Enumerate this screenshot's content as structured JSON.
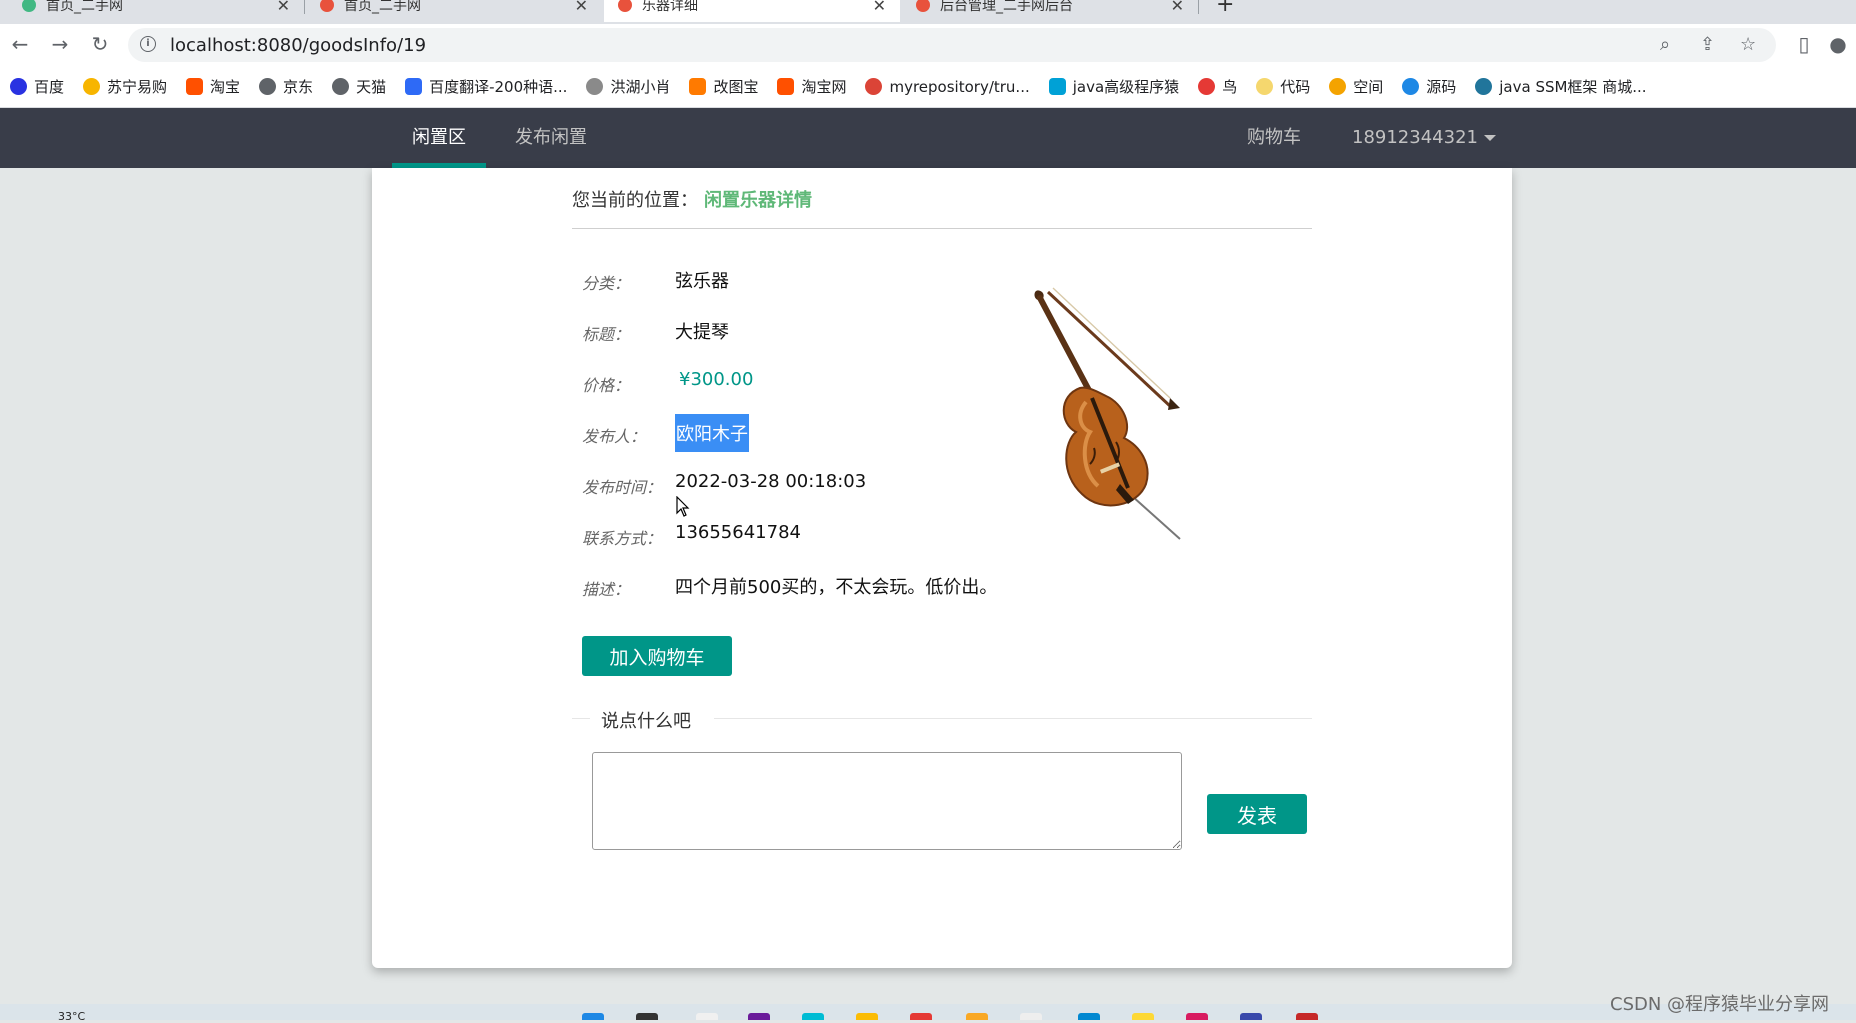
{
  "browser": {
    "tabs": [
      {
        "title": "首页_二手网",
        "favicon_color": "#41b883",
        "active": false
      },
      {
        "title": "首页_二手网",
        "favicon_color": "#e8523c",
        "active": false
      },
      {
        "title": "乐器详细",
        "favicon_color": "#e8523c",
        "active": true
      },
      {
        "title": "后台管理_二手网后台",
        "favicon_color": "#e8523c",
        "active": false
      }
    ],
    "url": "localhost:8080/goodsInfo/19",
    "bookmarks": [
      {
        "label": "百度",
        "color": "#2932e1"
      },
      {
        "label": "苏宁易购",
        "color": "#f7b500"
      },
      {
        "label": "淘宝",
        "color": "#ff5000"
      },
      {
        "label": "京东",
        "color": "#5f6368"
      },
      {
        "label": "天猫",
        "color": "#5f6368"
      },
      {
        "label": "百度翻译-200种语...",
        "color": "#2e6af6"
      },
      {
        "label": "洪湖小肖",
        "color": "#8a8a8a"
      },
      {
        "label": "改图宝",
        "color": "#ff7a00"
      },
      {
        "label": "淘宝网",
        "color": "#ff5000"
      },
      {
        "label": "myrepository/tru...",
        "color": "#db4437"
      },
      {
        "label": "java高级程序猿",
        "color": "#00a1d6"
      },
      {
        "label": "鸟",
        "color": "#e53935"
      },
      {
        "label": "代码",
        "color": "#f5d76e"
      },
      {
        "label": "空间",
        "color": "#f4a300"
      },
      {
        "label": "源码",
        "color": "#1e88e5"
      },
      {
        "label": "java SSM框架 商城...",
        "color": "#21759b"
      }
    ]
  },
  "navbar": {
    "left_items": [
      "闲置区",
      "发布闲置"
    ],
    "cart_label": "购物车",
    "user_label": "18912344321"
  },
  "breadcrumb": {
    "prefix": "您当前的位置：",
    "current": "闲置乐器详情"
  },
  "details": [
    {
      "label": "分类：",
      "value": "弦乐器"
    },
    {
      "label": "标题：",
      "value": "大提琴"
    },
    {
      "label": "价格：",
      "value": "¥300.00"
    },
    {
      "label": "发布人：",
      "value": "欧阳木子"
    },
    {
      "label": "发布时间：",
      "value": "2022-03-28 00:18:03"
    },
    {
      "label": "联系方式：",
      "value": "13655641784"
    },
    {
      "label": "描述：",
      "value": "四个月前500买的，不太会玩。低价出。"
    }
  ],
  "actions": {
    "add_to_cart": "加入购物车",
    "comment_heading": "说点什么吧",
    "comment_placeholder": "",
    "post": "发表"
  },
  "system": {
    "temperature": "33°C",
    "watermark": "CSDN @程序猿毕业分享网"
  },
  "colors": {
    "navbar_bg": "#393d49",
    "accent": "#009688",
    "breadcrumb_highlight": "#5fb878",
    "selection": "#3a8ef5"
  }
}
